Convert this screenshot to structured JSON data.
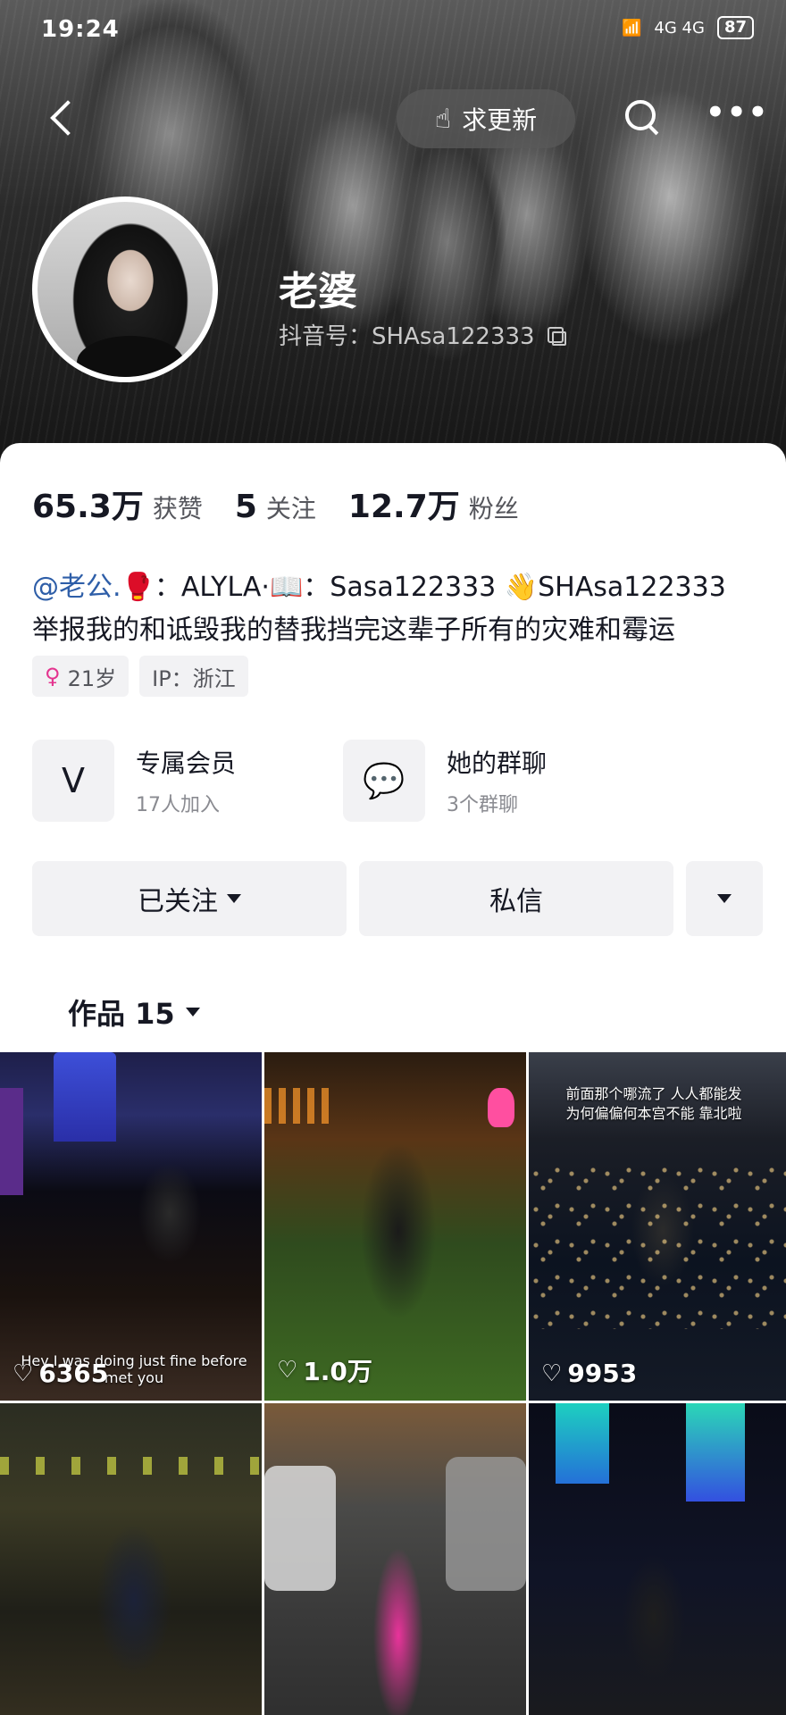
{
  "status_bar": {
    "time": "19:24",
    "network": "4G 4G",
    "battery": "87"
  },
  "header": {
    "request_update_label": "求更新",
    "request_update_icon": "hand-pointer-icon",
    "more_label": "•••",
    "nickname": "老婆",
    "douyin_id": "抖音号：SHAsa122333"
  },
  "stats": [
    {
      "value": "65.3万",
      "label": "获赞"
    },
    {
      "value": "5",
      "label": "关注"
    },
    {
      "value": "12.7万",
      "label": "粉丝"
    }
  ],
  "bio": {
    "mention": "@老公.",
    "line1_rest": "🥊：ALYLA·📖：Sasa122333 👋SHAsa122333",
    "line2": "举报我的和诋毁我的替我挡完这辈子所有的灾难和霉运"
  },
  "tags": {
    "gender_icon": "♀",
    "age": "21岁",
    "ip": "IP：浙江"
  },
  "features": [
    {
      "title": "专属会员",
      "subtitle": "17人加入",
      "icon": "V"
    },
    {
      "title": "她的群聊",
      "subtitle": "3个群聊",
      "icon": "💬"
    }
  ],
  "actions": {
    "follow": "已关注",
    "message": "私信"
  },
  "works_tab": "作品 15",
  "videos": [
    {
      "likes": "6365",
      "caption": "Hey I was doing just fine before met you"
    },
    {
      "likes": "1.0万",
      "caption": ""
    },
    {
      "likes": "9953",
      "caption": "前面那个哪流了 人人都能发 为何偏偏何本宫不能 靠北啦"
    },
    {
      "likes": "",
      "caption": ""
    },
    {
      "likes": "",
      "caption": ""
    },
    {
      "likes": "",
      "caption": ""
    }
  ],
  "colors": {
    "mention": "#2e5ea8",
    "female": "#e4348f",
    "button_bg": "#f2f2f4"
  }
}
